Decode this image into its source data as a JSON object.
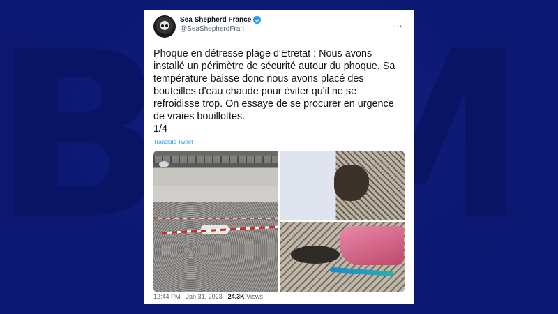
{
  "tweet": {
    "display_name": "Sea Shepherd France",
    "handle": "@SeaShepherdFran",
    "text": "Phoque en détresse plage d'Etretat : Nous avons installé un périmètre de sécurité autour du phoque. Sa température baisse donc nous avons placé des bouteilles d'eau chaude pour éviter qu'il ne se refroidisse trop. On essaye de se procurer en urgence de vraies bouillottes.\n1/4",
    "translate_label": "Translate Tweet",
    "time": "12:44 PM",
    "date": "Jan 31, 2023",
    "views_count": "24.3K",
    "views_label": "Views",
    "more_icon": "…"
  },
  "colors": {
    "background": "#0b1770",
    "link": "#1d9bf0",
    "verified": "#1d9bf0"
  }
}
